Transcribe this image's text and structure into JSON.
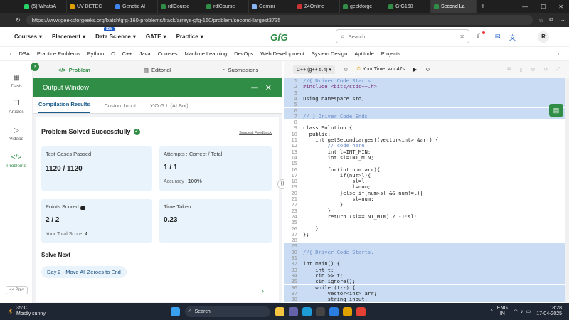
{
  "browser": {
    "tabs": [
      {
        "label": "(5) WhatsA",
        "color": "#25d366",
        "active": false
      },
      {
        "label": "UV DETEC",
        "color": "#e0a000",
        "active": false
      },
      {
        "label": "Genetic Al",
        "color": "#4285f4",
        "active": false
      },
      {
        "label": "rdlCourse",
        "color": "#2f8d46",
        "active": false
      },
      {
        "label": "rdlCourse",
        "color": "#2f8d46",
        "active": false
      },
      {
        "label": "Gemini",
        "color": "#8ab4f8",
        "active": false
      },
      {
        "label": "24Online",
        "color": "#cc3333",
        "active": false
      },
      {
        "label": "geekforge",
        "color": "#2f8d46",
        "active": false
      },
      {
        "label": "GfG160 -",
        "color": "#2f8d46",
        "active": false
      },
      {
        "label": "Second La",
        "color": "#2f8d46",
        "active": true
      }
    ],
    "new_tab": "+",
    "url": "https://www.geeksforgeeks.org/batch/gfg-160-problems/track/arrays-gfg-160/problem/second-largest3735"
  },
  "site_header": {
    "nav": [
      "Courses",
      "Placement",
      "Data Science",
      "GATE",
      "Practice"
    ],
    "badge": "IBM",
    "logo": "GfG",
    "search_placeholder": "Search...",
    "avatar": "R"
  },
  "subnav": [
    "DSA",
    "Practice Problems",
    "Python",
    "C",
    "C++",
    "Java",
    "Courses",
    "Machine Learning",
    "DevOps",
    "Web Development",
    "System Design",
    "Aptitude",
    "Projects"
  ],
  "rail": {
    "items": [
      "Dash",
      "Articles",
      "Videos",
      "Problems"
    ],
    "prev": "<< Prev"
  },
  "problem_tabs": [
    "Problem",
    "Editorial",
    "Submissions"
  ],
  "output_window": {
    "title": "Output Window",
    "tabs": [
      "Compilation Results",
      "Custom Input",
      "Y.O.G.I. (AI Bot)"
    ],
    "status": "Problem Solved Successfully",
    "feedback": "Suggest Feedback",
    "cards": {
      "tests_label": "Test Cases Passed",
      "tests_value": "1120 / 1120",
      "attempts_label": "Attempts : Correct / Total",
      "attempts_value": "1 / 1",
      "accuracy_label": "Accuracy :",
      "accuracy_value": "100%",
      "points_label": "Points Scored",
      "points_value": "2 / 2",
      "total_label": "Your Total Score:",
      "total_value": "4",
      "time_label": "Time Taken",
      "time_value": "0.23"
    },
    "solve_next_label": "Solve Next",
    "solve_next_item": "Day 2 - Move All Zeroes to End"
  },
  "editor": {
    "language": "C++ (g++ 5.4)",
    "timer_label": "Your Time:",
    "timer_value": "4m 47s"
  },
  "code_lines": [
    {
      "n": "1",
      "t": "//{ Driver Code Starts",
      "c": "cm",
      "hl": true
    },
    {
      "n": "2",
      "t": "#include <bits/stdc++.h>",
      "c": "pp",
      "hl": true
    },
    {
      "n": "3",
      "t": "",
      "c": "",
      "hl": true
    },
    {
      "n": "4",
      "t": "using namespace std;",
      "c": "",
      "hl": true
    },
    {
      "n": "5",
      "t": "",
      "c": "",
      "hl": true
    },
    {
      "n": "6",
      "t": "",
      "c": "",
      "hl": true
    },
    {
      "n": "7",
      "t": "// } Driver Code Ends",
      "c": "cm",
      "hl": true
    },
    {
      "n": "8",
      "t": "",
      "c": "",
      "hl": false
    },
    {
      "n": "9",
      "t": "class Solution {",
      "c": "",
      "hl": false
    },
    {
      "n": "10",
      "t": "  public:",
      "c": "",
      "hl": false
    },
    {
      "n": "11",
      "t": "    int getSecondLargest(vector<int> &arr) {",
      "c": "",
      "hl": false
    },
    {
      "n": "12",
      "t": "        // code here",
      "c": "cm",
      "hl": false
    },
    {
      "n": "13",
      "t": "        int l=INT_MIN;",
      "c": "",
      "hl": false
    },
    {
      "n": "14",
      "t": "        int sl=INT_MIN;",
      "c": "",
      "hl": false
    },
    {
      "n": "15",
      "t": "",
      "c": "",
      "hl": false
    },
    {
      "n": "16",
      "t": "        for(int num:arr){",
      "c": "",
      "hl": false
    },
    {
      "n": "17",
      "t": "            if(num>l){",
      "c": "",
      "hl": false
    },
    {
      "n": "18",
      "t": "                sl=l;",
      "c": "",
      "hl": false
    },
    {
      "n": "19",
      "t": "                l=num;",
      "c": "",
      "hl": false
    },
    {
      "n": "20",
      "t": "            }else if(num>sl && num!=l){",
      "c": "",
      "hl": false
    },
    {
      "n": "21",
      "t": "                sl=num;",
      "c": "",
      "hl": false
    },
    {
      "n": "22",
      "t": "            }",
      "c": "",
      "hl": false
    },
    {
      "n": "23",
      "t": "        }",
      "c": "",
      "hl": false
    },
    {
      "n": "24",
      "t": "        return (sl==INT_MIN) ? -1:sl;",
      "c": "",
      "hl": false
    },
    {
      "n": "25",
      "t": "",
      "c": "",
      "hl": false
    },
    {
      "n": "26",
      "t": "    }",
      "c": "",
      "hl": false
    },
    {
      "n": "27",
      "t": "};",
      "c": "",
      "hl": false
    },
    {
      "n": "28",
      "t": "",
      "c": "",
      "hl": false
    },
    {
      "n": "29",
      "t": "",
      "c": "",
      "hl": true
    },
    {
      "n": "30",
      "t": "//{ Driver Code Starts.",
      "c": "cm",
      "hl": true
    },
    {
      "n": "31",
      "t": "",
      "c": "",
      "hl": true
    },
    {
      "n": "32",
      "t": "int main() {",
      "c": "",
      "hl": true
    },
    {
      "n": "33",
      "t": "    int t;",
      "c": "",
      "hl": true
    },
    {
      "n": "34",
      "t": "    cin >> t;",
      "c": "",
      "hl": true
    },
    {
      "n": "35",
      "t": "    cin.ignore();",
      "c": "",
      "hl": true
    },
    {
      "n": "36",
      "t": "    while (t--) {",
      "c": "",
      "hl": true
    },
    {
      "n": "37",
      "t": "        vector<int> arr;",
      "c": "",
      "hl": true
    },
    {
      "n": "38",
      "t": "        string input;",
      "c": "",
      "hl": true
    }
  ],
  "taskbar": {
    "weather_temp": "35°C",
    "weather_desc": "Mostly sunny",
    "search": "Search",
    "lang1": "ENG",
    "lang2": "IN",
    "time": "18:28",
    "date": "17-04-2025"
  },
  "colors": {
    "brand_green": "#2f8d46",
    "highlight": "#c9dcf3",
    "card_bg": "#e8f3fb"
  }
}
